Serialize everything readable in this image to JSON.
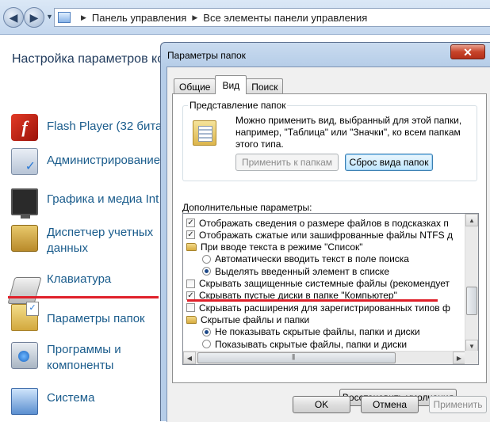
{
  "address_bar": {
    "crumbs": [
      "Панель управления",
      "Все элементы панели управления"
    ]
  },
  "control_panel": {
    "heading": "Настройка параметров ко",
    "items": [
      {
        "label": "Flash Player (32 бита",
        "icon": "flash-player-icon"
      },
      {
        "label": "Администрирование",
        "icon": "administration-icon"
      },
      {
        "label": "Графика и медиа Int",
        "icon": "graphics-media-icon"
      },
      {
        "label": "Диспетчер учетных\nданных",
        "icon": "credential-manager-icon"
      },
      {
        "label": "Клавиатура",
        "icon": "keyboard-icon"
      },
      {
        "label": "Параметры папок",
        "icon": "folder-options-icon"
      },
      {
        "label": "Программы и\nкомпоненты",
        "icon": "programs-features-icon"
      },
      {
        "label": "Система",
        "icon": "system-icon"
      }
    ]
  },
  "dialog": {
    "title": "Параметры папок",
    "close_label": "✕",
    "tabs": [
      {
        "label": "Общие",
        "active": false
      },
      {
        "label": "Вид",
        "active": true
      },
      {
        "label": "Поиск",
        "active": false
      }
    ],
    "folder_view": {
      "title": "Представление папок",
      "description": "Можно применить вид, выбранный для этой папки, например, \"Таблица\" или \"Значки\", ко всем папкам этого типа.",
      "apply_button": "Применить к папкам",
      "reset_button": "Сброс вида папок"
    },
    "advanced": {
      "label": "Дополнительные параметры:",
      "rows": [
        {
          "type": "checkbox",
          "checked": true,
          "indent": 0,
          "text": "Отображать сведения о размере файлов в подсказках п"
        },
        {
          "type": "checkbox",
          "checked": true,
          "indent": 0,
          "text": "Отображать сжатые или зашифрованные файлы NTFS д"
        },
        {
          "type": "folder",
          "indent": 0,
          "text": "При вводе текста в режиме \"Список\""
        },
        {
          "type": "radio",
          "checked": false,
          "indent": 1,
          "text": "Автоматически вводить текст в поле поиска"
        },
        {
          "type": "radio",
          "checked": true,
          "indent": 1,
          "text": "Выделять введенный элемент в списке"
        },
        {
          "type": "checkbox",
          "checked": false,
          "indent": 0,
          "text": "Скрывать защищенные системные файлы (рекомендует"
        },
        {
          "type": "checkbox",
          "checked": true,
          "indent": 0,
          "text": "Скрывать пустые диски в папке \"Компьютер\""
        },
        {
          "type": "checkbox",
          "checked": false,
          "indent": 0,
          "text": "Скрывать расширения для зарегистрированных типов ф"
        },
        {
          "type": "folder",
          "indent": 0,
          "text": "Скрытые файлы и папки"
        },
        {
          "type": "radio",
          "checked": true,
          "indent": 1,
          "text": "Не показывать скрытые файлы, папки и диски"
        },
        {
          "type": "radio",
          "checked": false,
          "indent": 1,
          "text": "Показывать скрытые файлы, папки и диски"
        }
      ]
    },
    "restore_button": "Восстановить умолчания",
    "ok_button": "OK",
    "cancel_button": "Отмена",
    "apply_button": "Применить"
  },
  "colors": {
    "link_blue": "#1a5c8c",
    "highlight_red": "#e0202a"
  }
}
